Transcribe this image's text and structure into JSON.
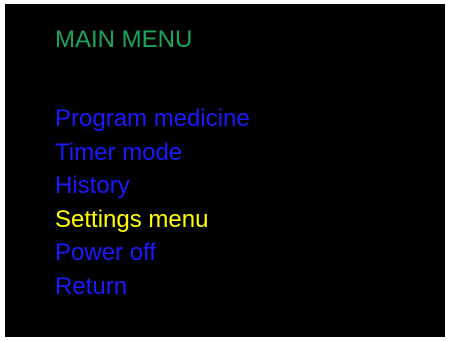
{
  "title": "MAIN MENU",
  "menu": {
    "items": [
      {
        "label": "Program medicine",
        "selected": false
      },
      {
        "label": "Timer mode",
        "selected": false
      },
      {
        "label": "History",
        "selected": false
      },
      {
        "label": "Settings menu",
        "selected": true
      },
      {
        "label": "Power off",
        "selected": false
      },
      {
        "label": "Return",
        "selected": false
      }
    ]
  },
  "colors": {
    "background": "#000000",
    "title": "#1aa65a",
    "item": "#1a1aff",
    "selected_item": "#ffff00"
  }
}
